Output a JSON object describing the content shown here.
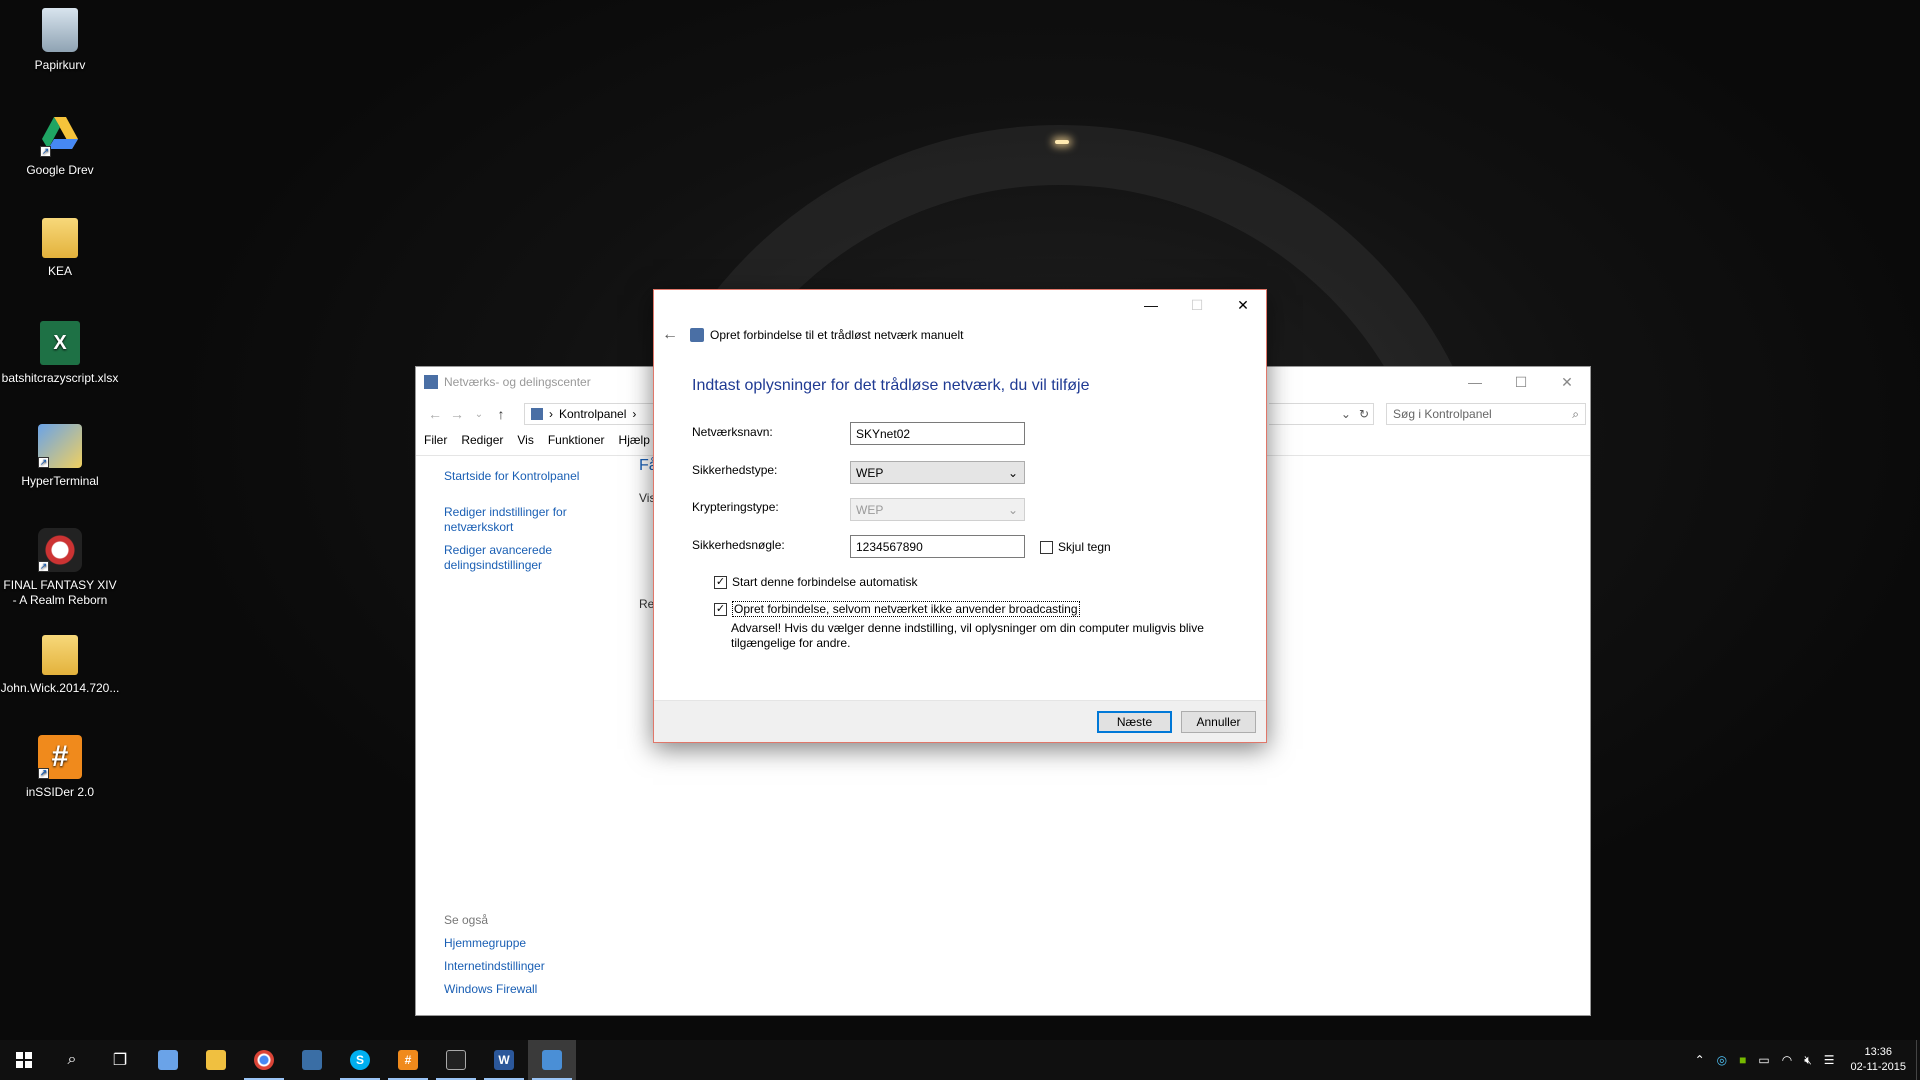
{
  "desktop": {
    "icons": [
      {
        "label": "Papirkurv",
        "icon": "recycle-bin-icon"
      },
      {
        "label": "Google Drev",
        "icon": "google-drive-icon"
      },
      {
        "label": "KEA",
        "icon": "folder-icon"
      },
      {
        "label": "batshitcrazyscript.xlsx",
        "icon": "excel-file-icon"
      },
      {
        "label": "HyperTerminal",
        "icon": "hyperterminal-icon"
      },
      {
        "label": "FINAL FANTASY XIV - A Realm Reborn",
        "icon": "final-fantasy-icon"
      },
      {
        "label": "John.Wick.2014.720...",
        "icon": "folder-icon"
      },
      {
        "label": "inSSIDer 2.0",
        "icon": "inssider-icon"
      }
    ]
  },
  "background_window": {
    "title": "Netværks- og delingscenter",
    "breadcrumb": "Kontrolpanel",
    "search_placeholder": "Søg i Kontrolpanel",
    "menu": [
      "Filer",
      "Rediger",
      "Vis",
      "Funktioner",
      "Hjælp"
    ],
    "sidebar_links": [
      "Startside for Kontrolpanel",
      "Rediger indstillinger for netværkskort",
      "Rediger avancerede delingsindstillinger"
    ],
    "see_also_heading": "Se også",
    "see_also_links": [
      "Hjemmegruppe",
      "Internetindstillinger",
      "Windows Firewall"
    ],
    "cut_heading": "Få",
    "cut_text_1": "Vis",
    "cut_text_2": "Ret"
  },
  "dialog": {
    "title": "Opret forbindelse til et trådløst netværk manuelt",
    "heading": "Indtast oplysninger for det trådløse netværk, du vil tilføje",
    "fields": {
      "network_name_label": "Netværksnavn:",
      "network_name_value": "SKYnet02",
      "security_type_label": "Sikkerhedstype:",
      "security_type_value": "WEP",
      "encryption_type_label": "Krypteringstype:",
      "encryption_type_value": "WEP",
      "security_key_label": "Sikkerhedsnøgle:",
      "security_key_value": "1234567890",
      "hide_chars_label": "Skjul tegn"
    },
    "checkboxes": {
      "auto_start_label": "Start denne forbindelse automatisk",
      "auto_start_checked": true,
      "connect_no_broadcast_label": "Opret forbindelse, selvom netværket ikke anvender broadcasting",
      "connect_no_broadcast_checked": true,
      "hide_chars_checked": false
    },
    "warning": "Advarsel! Hvis du vælger denne indstilling, vil oplysninger om din computer muligvis blive tilgængelige for andre.",
    "buttons": {
      "next": "Næste",
      "cancel": "Annuller"
    }
  },
  "taskbar": {
    "clock_time": "13:36",
    "clock_date": "02-11-2015"
  },
  "colors": {
    "accent": "#0078d7",
    "link": "#1a5fb4",
    "heading": "#1f3a93",
    "dialog_border": "#e0776a"
  }
}
